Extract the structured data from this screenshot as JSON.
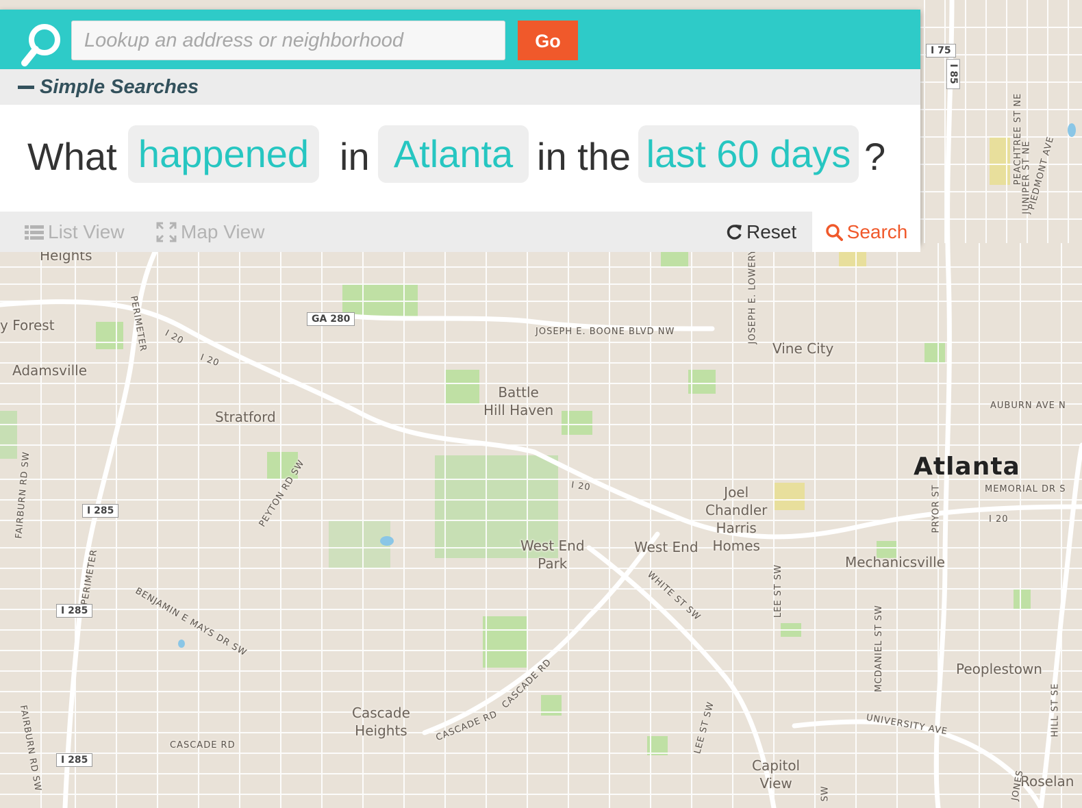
{
  "search": {
    "placeholder": "Lookup an address or neighborhood",
    "value": "",
    "go_label": "Go"
  },
  "simple_searches": {
    "toggle_label": "Simple Searches"
  },
  "query": {
    "prefix": "What",
    "event": "happened",
    "in_word": "in",
    "location": "Atlanta",
    "time_word": "in the",
    "timeframe": "last 60 days",
    "suffix": "?"
  },
  "actions": {
    "list_view": "List View",
    "map_view": "Map View",
    "reset": "Reset",
    "search": "Search"
  },
  "colors": {
    "accent": "#2ecbc8",
    "go": "#f0592b",
    "chip_text": "#26c6c1",
    "label_dark": "#33515c",
    "map_land": "#e9e2d8",
    "map_park": "#bfe0a4",
    "map_road": "#ffffff"
  },
  "map": {
    "city": "Atlanta",
    "neighborhoods": {
      "heights": "Heights",
      "forest": "y Forest",
      "adamsville": "Adamsville",
      "stratford": "Stratford",
      "battle_hill": "Battle\nHill Haven",
      "vine_city": "Vine City",
      "joel": "Joel\nChandler\nHarris\nHomes",
      "west_end_park": "West End\nPark",
      "west_end": "West End",
      "mechanicsville": "Mechanicsville",
      "peoplestown": "Peoplestown",
      "cascade": "Cascade\nHeights",
      "capitol": "Capitol\nView",
      "roselan": "Roselan"
    },
    "roads": {
      "perimeter1": "PERIMETER",
      "perimeter2": "PERIMETER",
      "i20a": "I 20",
      "i20b": "I 20",
      "i20c": "I 20",
      "i20d": "I 20",
      "boone": "JOSEPH E. BOONE BLVD NW",
      "lowery": "JOSEPH E. LOWERY",
      "auburn": "AUBURN AVE N",
      "memorial": "MEMORIAL DR S",
      "peyton": "PEYTON RD SW",
      "fairburn1": "FAIRBURN RD SW",
      "fairburn2": "FAIRBURN RD SW",
      "benjamin": "BENJAMIN E MAYS DR SW",
      "white": "WHITE ST SW",
      "lee1": "LEE ST SW",
      "lee2": "LEE ST SW",
      "cascade1": "CASCADE RD",
      "cascade2": "CASCADE RD",
      "cascade3": "CASCADE RD",
      "mcdaniel": "MCDANIEL ST SW",
      "university": "UNIVERSITY AVE",
      "pryor": "PRYOR ST",
      "peachtree": "PEACHTREE ST NE",
      "juniper": "JUNIPER ST NE",
      "piedmont": "PIEDMONT AVE",
      "hill": "HILL ST SE",
      "jones": "JONES",
      "sw": "SW"
    },
    "shields": {
      "ga280": "GA 280",
      "i75": "I 75",
      "i285a": "I 285",
      "i285b": "I 285",
      "i285c": "I 285",
      "i85": "I 85"
    }
  }
}
